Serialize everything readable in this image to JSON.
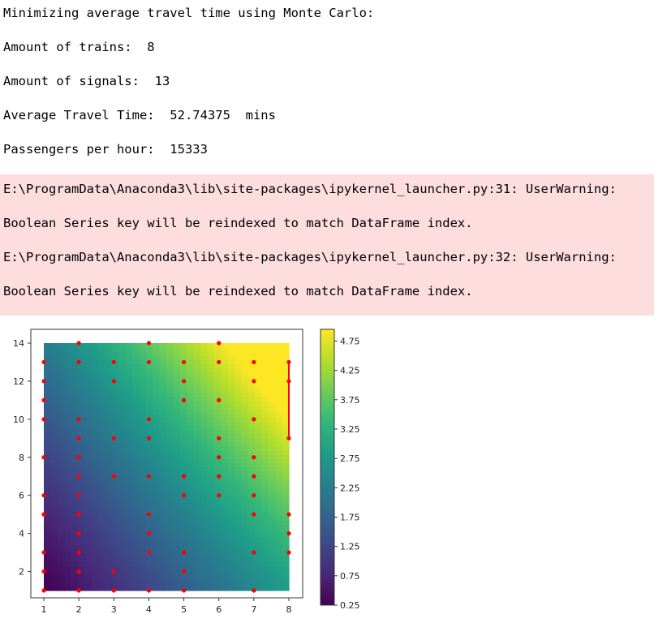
{
  "output": {
    "title": "Minimizing average travel time using Monte Carlo:",
    "trains": "Amount of trains:  8",
    "signals": "Amount of signals:  13",
    "travel_time": "Average Travel Time:  52.74375  mins",
    "passengers": "Passengers per hour:  15333"
  },
  "stderr": {
    "line1": "E:\\ProgramData\\Anaconda3\\lib\\site-packages\\ipykernel_launcher.py:31: UserWarning:",
    "line2": "Boolean Series key will be reindexed to match DataFrame index.",
    "line3": "E:\\ProgramData\\Anaconda3\\lib\\site-packages\\ipykernel_launcher.py:32: UserWarning:",
    "line4": "Boolean Series key will be reindexed to match DataFrame index."
  },
  "chart_data": {
    "type": "heatmap",
    "colormap": "viridis",
    "xlim": [
      1,
      8
    ],
    "ylim": [
      1,
      14
    ],
    "x_ticks": [
      "1",
      "2",
      "3",
      "4",
      "5",
      "6",
      "7",
      "8"
    ],
    "y_ticks": [
      "2",
      "4",
      "6",
      "8",
      "10",
      "12",
      "14"
    ],
    "colorbar_ticks": [
      "0.25",
      "0.75",
      "1.25",
      "1.75",
      "2.25",
      "2.75",
      "3.25",
      "3.75",
      "4.25",
      "4.75"
    ],
    "colorbar_range": [
      0.25,
      4.95
    ],
    "marker_color": "#ff0000",
    "points": [
      [
        1,
        1
      ],
      [
        1,
        2
      ],
      [
        1,
        3
      ],
      [
        1,
        5
      ],
      [
        1,
        6
      ],
      [
        1,
        8
      ],
      [
        1,
        10
      ],
      [
        1,
        11
      ],
      [
        1,
        12
      ],
      [
        1,
        13
      ],
      [
        2,
        1
      ],
      [
        2,
        2
      ],
      [
        2,
        3
      ],
      [
        2,
        4
      ],
      [
        2,
        5
      ],
      [
        2,
        6
      ],
      [
        2,
        7
      ],
      [
        2,
        8
      ],
      [
        2,
        9
      ],
      [
        2,
        10
      ],
      [
        2,
        13
      ],
      [
        2,
        14
      ],
      [
        3,
        1
      ],
      [
        3,
        2
      ],
      [
        3,
        7
      ],
      [
        3,
        9
      ],
      [
        3,
        12
      ],
      [
        3,
        13
      ],
      [
        4,
        1
      ],
      [
        4,
        3
      ],
      [
        4,
        4
      ],
      [
        4,
        5
      ],
      [
        4,
        7
      ],
      [
        4,
        9
      ],
      [
        4,
        10
      ],
      [
        4,
        13
      ],
      [
        4,
        14
      ],
      [
        5,
        1
      ],
      [
        5,
        2
      ],
      [
        5,
        3
      ],
      [
        5,
        6
      ],
      [
        5,
        7
      ],
      [
        5,
        11
      ],
      [
        5,
        12
      ],
      [
        5,
        13
      ],
      [
        6,
        6
      ],
      [
        6,
        7
      ],
      [
        6,
        8
      ],
      [
        6,
        9
      ],
      [
        6,
        11
      ],
      [
        6,
        13
      ],
      [
        6,
        14
      ],
      [
        7,
        1
      ],
      [
        7,
        3
      ],
      [
        7,
        5
      ],
      [
        7,
        6
      ],
      [
        7,
        7
      ],
      [
        7,
        8
      ],
      [
        7,
        10
      ],
      [
        7,
        12
      ],
      [
        7,
        13
      ],
      [
        8,
        3
      ],
      [
        8,
        4
      ],
      [
        8,
        5
      ],
      [
        8,
        9
      ],
      [
        8,
        12
      ],
      [
        8,
        13
      ]
    ],
    "segments": [
      [
        [
          8,
          9
        ],
        [
          8,
          13
        ]
      ]
    ]
  }
}
